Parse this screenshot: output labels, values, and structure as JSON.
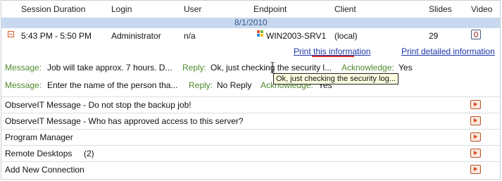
{
  "columns": {
    "session_duration": "Session Duration",
    "login": "Login",
    "user": "User",
    "endpoint": "Endpoint",
    "client": "Client",
    "slides": "Slides",
    "video": "Video"
  },
  "date_header": "8/1/2010",
  "session": {
    "duration": "5:43 PM - 5:50 PM",
    "login": "Administrator",
    "user": "n/a",
    "endpoint": "WIN2003-SRV1",
    "client": "(local)",
    "slides": "29"
  },
  "links": {
    "print_info": "Print this information",
    "print_detailed": "Print detailed information"
  },
  "labels": {
    "message": "Message:",
    "reply": "Reply:",
    "acknowledge": "Acknowledge:"
  },
  "messages": [
    {
      "message": "Job will take approx. 7 hours. D...",
      "reply": "Ok, just checking the security l...",
      "acknowledge": "Yes"
    },
    {
      "message": "Enter the name of the person tha...",
      "reply": "No Reply",
      "acknowledge": "Yes"
    }
  ],
  "tooltip": "Ok, just checking the security log...",
  "list": [
    {
      "label": "ObserveIT Message - Do not stop the backup job!"
    },
    {
      "label": "ObserveIT Message - Who has approved access to this server?"
    },
    {
      "label": "Program Manager"
    },
    {
      "label": "Remote Desktops",
      "count": "(2)"
    },
    {
      "label": "Add New Connection"
    }
  ],
  "colors": {
    "date_bar": "#c8d9ef",
    "link": "#1a35a8",
    "label_green": "#4f8a2f",
    "play_icon": "#d34b1d"
  },
  "icons": {
    "collapse": "collapse-minus-icon",
    "endpoint": "windows-logo-icon",
    "video": "video-camera-icon",
    "play": "play-video-icon",
    "cursor": "text-cursor-icon"
  }
}
